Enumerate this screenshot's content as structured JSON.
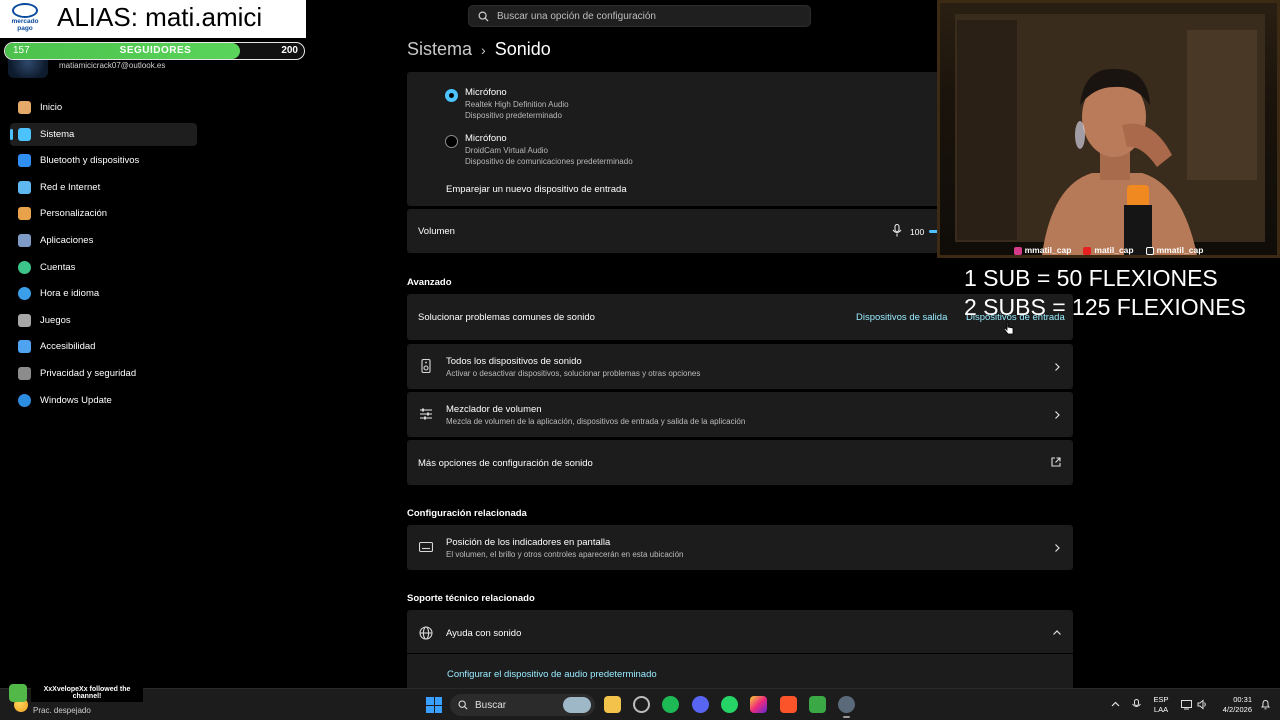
{
  "search": {
    "placeholder": "Buscar una opción de configuración"
  },
  "user": {
    "email": "matiamicicrack07@outlook.es"
  },
  "sidebar": {
    "items": [
      {
        "label": "Inicio",
        "icon": "home-icon",
        "color": "#e5a96a"
      },
      {
        "label": "Sistema",
        "icon": "monitor-icon",
        "color": "#4cc2ff",
        "active": true
      },
      {
        "label": "Bluetooth y dispositivos",
        "icon": "bluetooth-icon",
        "color": "#2f8ff5"
      },
      {
        "label": "Red e Internet",
        "icon": "wifi-icon",
        "color": "#60b8f0"
      },
      {
        "label": "Personalización",
        "icon": "brush-icon",
        "color": "#e8a24a"
      },
      {
        "label": "Aplicaciones",
        "icon": "apps-icon",
        "color": "#7e9cc7"
      },
      {
        "label": "Cuentas",
        "icon": "person-icon",
        "color": "#3cc48a"
      },
      {
        "label": "Hora e idioma",
        "icon": "globe-clock-icon",
        "color": "#3a9ee8"
      },
      {
        "label": "Juegos",
        "icon": "gamepad-icon",
        "color": "#a8a8a8"
      },
      {
        "label": "Accesibilidad",
        "icon": "accessibility-icon",
        "color": "#4fa3f0"
      },
      {
        "label": "Privacidad y seguridad",
        "icon": "shield-icon",
        "color": "#8c8c8c"
      },
      {
        "label": "Windows Update",
        "icon": "update-icon",
        "color": "#2b8ce0"
      }
    ]
  },
  "header": {
    "root": "Sistema",
    "separator": "›",
    "current": "Sonido"
  },
  "input_devices": [
    {
      "title": "Micrófono",
      "line1": "Realtek High Definition Audio",
      "line2": "Dispositivo predeterminado",
      "selected": true
    },
    {
      "title": "Micrófono",
      "line1": "DroidCam Virtual Audio",
      "line2": "Dispositivo de comunicaciones predeterminado",
      "selected": false
    }
  ],
  "pair_input": "Emparejar un nuevo dispositivo de entrada",
  "volume": {
    "label": "Volumen",
    "value": "100"
  },
  "advanced": {
    "title": "Avanzado",
    "troubleshoot": {
      "label": "Solucionar problemas comunes de sonido",
      "link_output": "Dispositivos de salida",
      "link_input": "Dispositivos de entrada"
    },
    "all_devices": {
      "title": "Todos los dispositivos de sonido",
      "subtitle": "Activar o desactivar dispositivos, solucionar problemas y otras opciones"
    },
    "mixer": {
      "title": "Mezclador de volumen",
      "subtitle": "Mezcla de volumen de la aplicación, dispositivos de entrada y salida de la aplicación"
    },
    "more": {
      "label": "Más opciones de configuración de sonido"
    }
  },
  "related": {
    "title": "Configuración relacionada",
    "indicators": {
      "title": "Posición de los indicadores en pantalla",
      "subtitle": "El volumen, el brillo y otros controles aparecerán en esta ubicación"
    }
  },
  "support": {
    "title": "Soporte técnico relacionado",
    "help": {
      "label": "Ayuda con sonido"
    },
    "config_link": "Configurar el dispositivo de audio predeterminado"
  },
  "overlay": {
    "mp_logo_text": "mercado pago",
    "alias": "ALIAS: mati.amici",
    "goal": {
      "current": "157",
      "label": "SEGUIDORES",
      "target": "200",
      "progress": 0.785
    },
    "socials": [
      "mmatil_cap",
      "matil_cap",
      "mmatil_cap"
    ],
    "promo_line1": "1 SUB = 50 FLEXIONES",
    "promo_line2": "2 SUBS = 125 FLEXIONES",
    "follow_alert": "XxXvelopeXx followed the channel!"
  },
  "taskbar": {
    "weather": "Prac. despejado",
    "search_label": "Buscar",
    "lang_line1": "ESP",
    "lang_line2": "LAA",
    "time": "00:31",
    "date": "4/2/2026"
  },
  "colors": {
    "accent": "#4cc2ff",
    "link": "#99ebff",
    "card": "#1c1c1c",
    "background": "#000000"
  }
}
